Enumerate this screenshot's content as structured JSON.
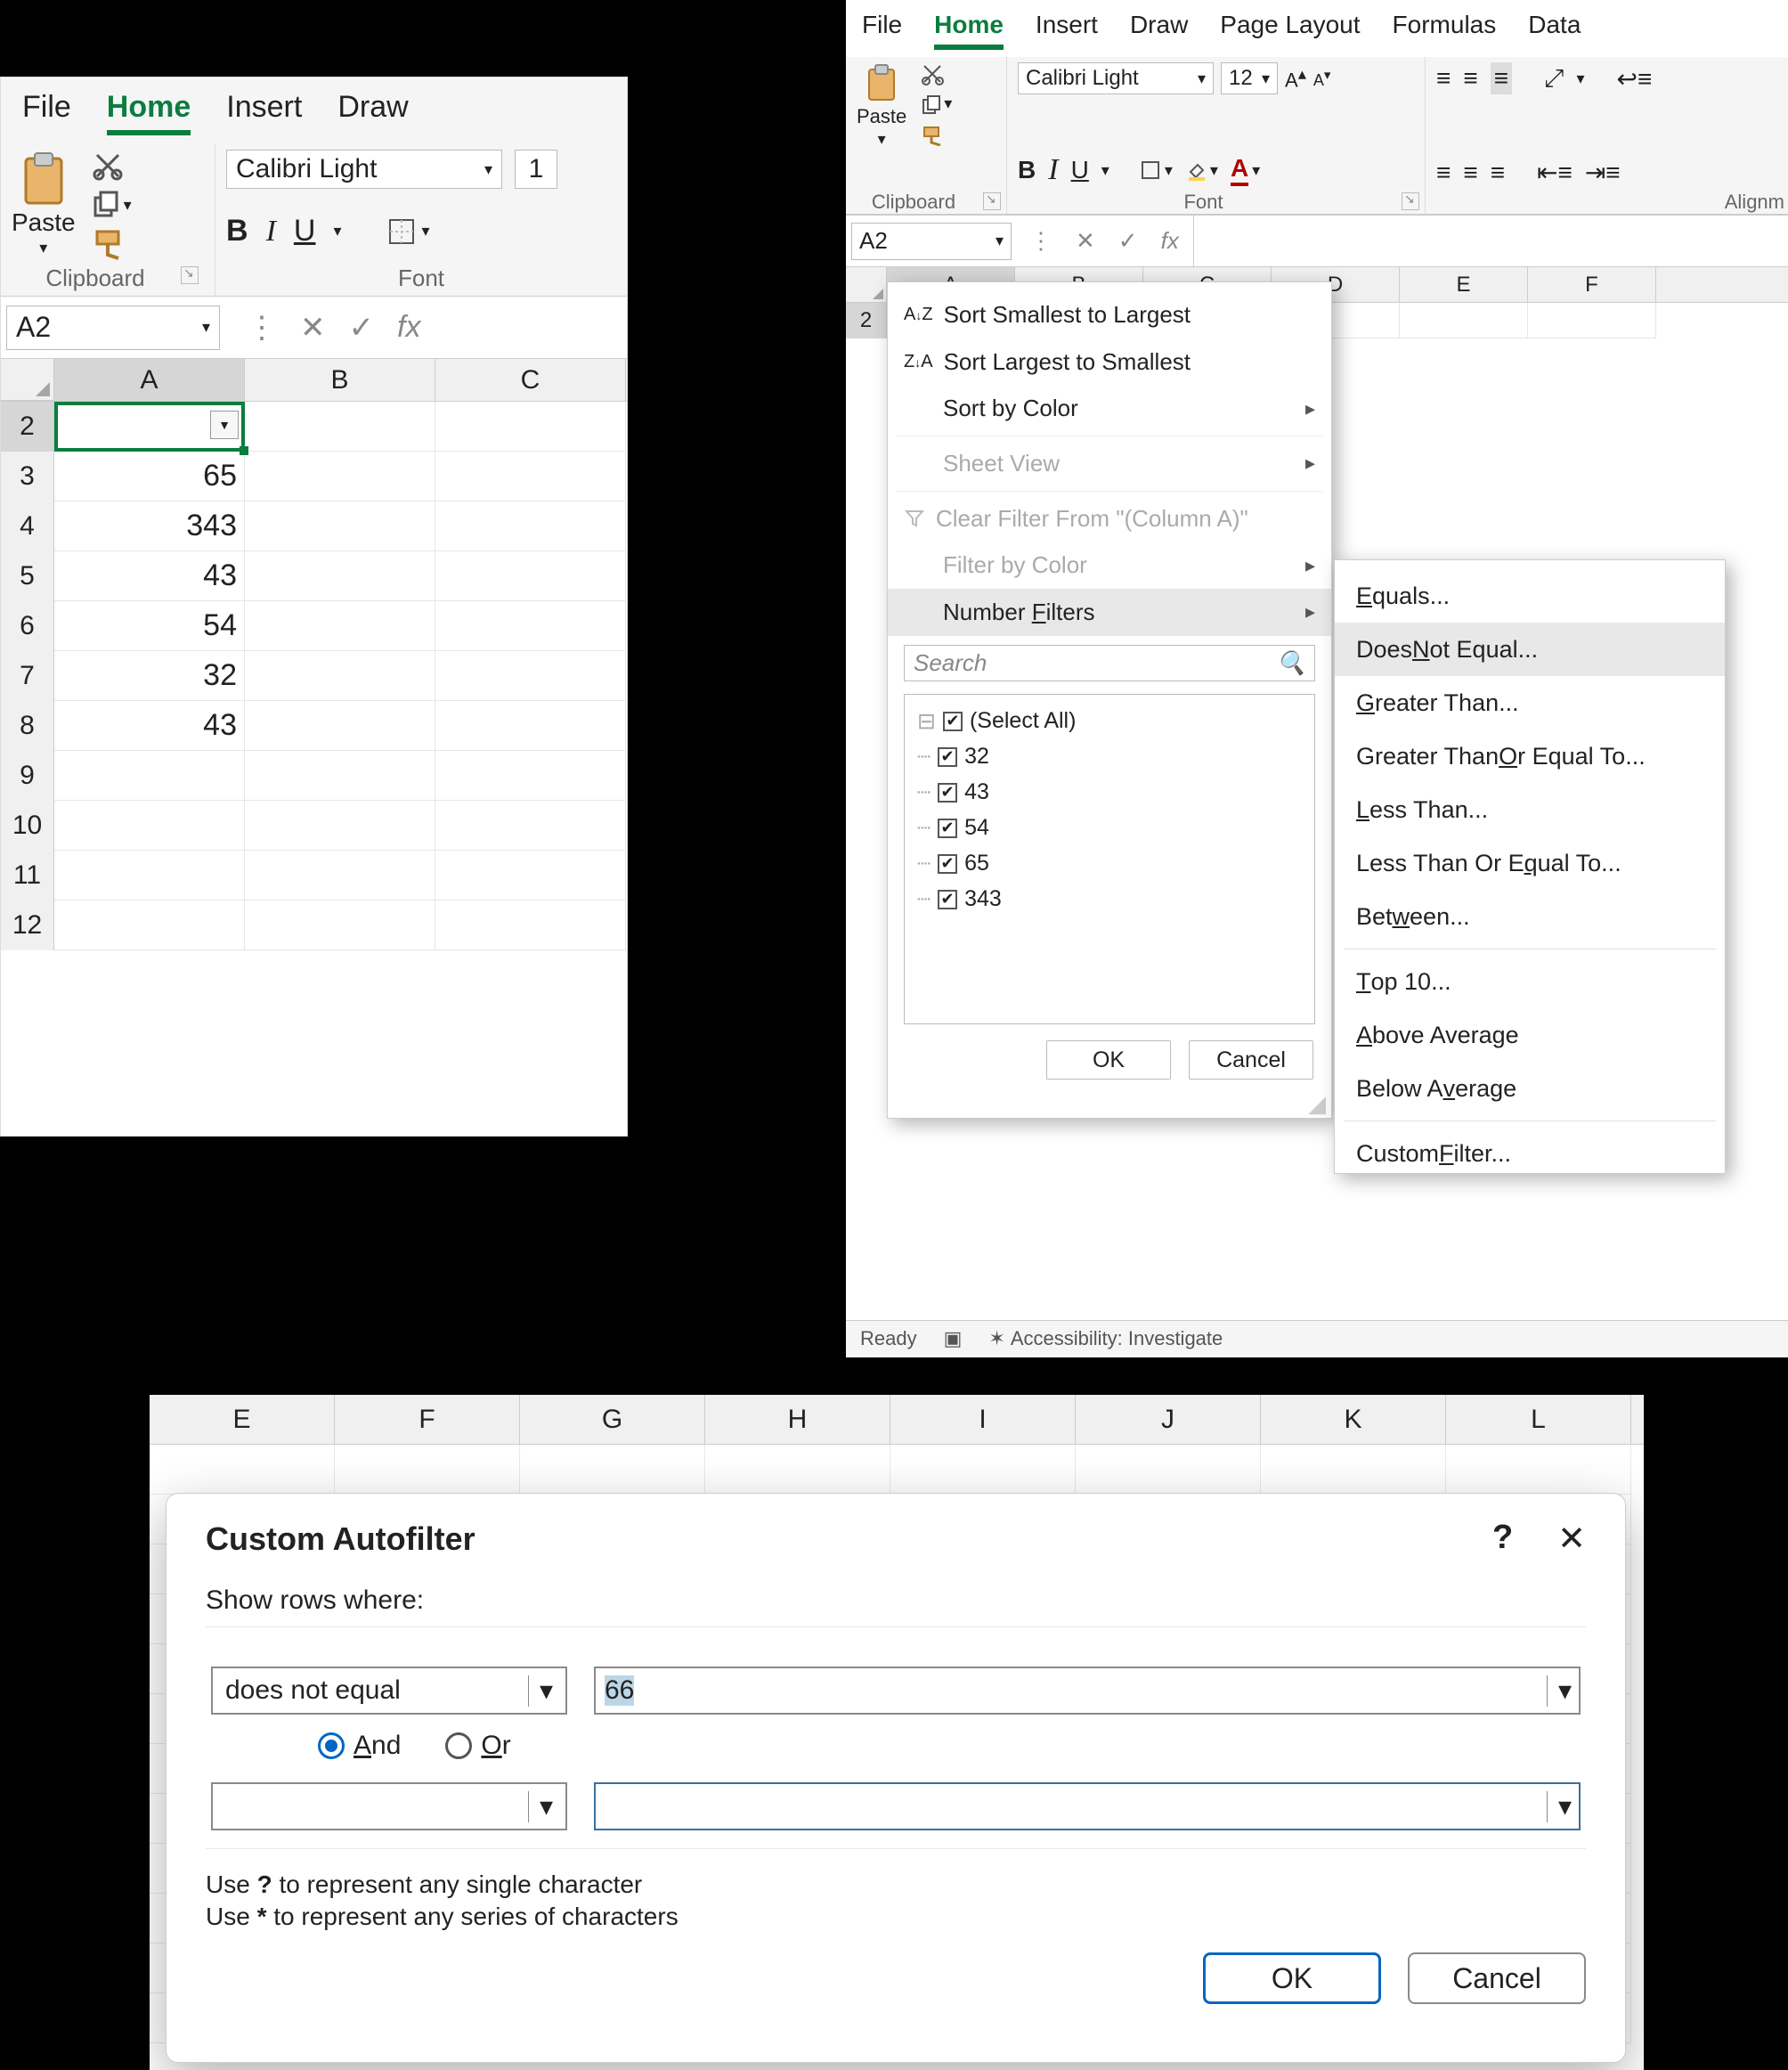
{
  "panel1": {
    "tabs": [
      "File",
      "Home",
      "Insert",
      "Draw"
    ],
    "active_tab": 1,
    "paste_label": "Paste",
    "clipboard_label": "Clipboard",
    "font_label": "Font",
    "font_name": "Calibri Light",
    "font_size": "1",
    "bold": "B",
    "italic": "I",
    "underline": "U",
    "namebox": "A2",
    "columns": [
      "A",
      "B",
      "C"
    ],
    "rows": [
      "2",
      "3",
      "4",
      "5",
      "6",
      "7",
      "8",
      "9",
      "10",
      "11",
      "12"
    ],
    "data_A": [
      "",
      "65",
      "343",
      "43",
      "54",
      "32",
      "43",
      "",
      "",
      "",
      ""
    ]
  },
  "panel2": {
    "tabs": [
      "File",
      "Home",
      "Insert",
      "Draw",
      "Page Layout",
      "Formulas",
      "Data"
    ],
    "active_tab": 1,
    "paste_label": "Paste",
    "clipboard_label": "Clipboard",
    "font_label": "Font",
    "align_label": "Alignm",
    "font_name": "Calibri Light",
    "font_size": "12",
    "bold": "B",
    "italic": "I",
    "underline": "U",
    "namebox": "A2",
    "fx_label": "fx",
    "columns": [
      "A",
      "B",
      "C",
      "D",
      "E",
      "F"
    ],
    "row": "2",
    "status_ready": "Ready",
    "status_access": "Accessibility: Investigate",
    "filter_menu": {
      "sort_asc": "Sort Smallest to Largest",
      "sort_desc": "Sort Largest to Smallest",
      "sort_color": "Sort by Color",
      "sheet_view": "Sheet View",
      "clear": "Clear Filter From \"(Column A)\"",
      "filter_color": "Filter by Color",
      "number_filters": "Number Filters",
      "search_placeholder": "Search",
      "select_all": "(Select All)",
      "items": [
        "32",
        "43",
        "54",
        "65",
        "343"
      ],
      "ok": "OK",
      "cancel": "Cancel"
    },
    "nf_menu": {
      "equals": "Equals...",
      "not_equal": "Does Not Equal...",
      "gt": "Greater Than...",
      "gte": "Greater Than Or Equal To...",
      "lt": "Less Than...",
      "lte": "Less Than Or Equal To...",
      "between": "Between...",
      "top10": "Top 10...",
      "above": "Above Average",
      "below": "Below Average",
      "custom": "Custom Filter..."
    }
  },
  "panel3": {
    "columns": [
      "E",
      "F",
      "G",
      "H",
      "I",
      "J",
      "K",
      "L"
    ],
    "dialog": {
      "title": "Custom Autofilter",
      "subtitle": "Show rows where:",
      "op1": "does not equal",
      "val1": "66",
      "and": "And",
      "or": "Or",
      "op2": "",
      "val2": "",
      "hint1_a": "Use ",
      "hint1_b": "?",
      "hint1_c": " to represent any single character",
      "hint2_a": "Use ",
      "hint2_b": "*",
      "hint2_c": " to represent any series of characters",
      "ok": "OK",
      "cancel": "Cancel"
    }
  }
}
